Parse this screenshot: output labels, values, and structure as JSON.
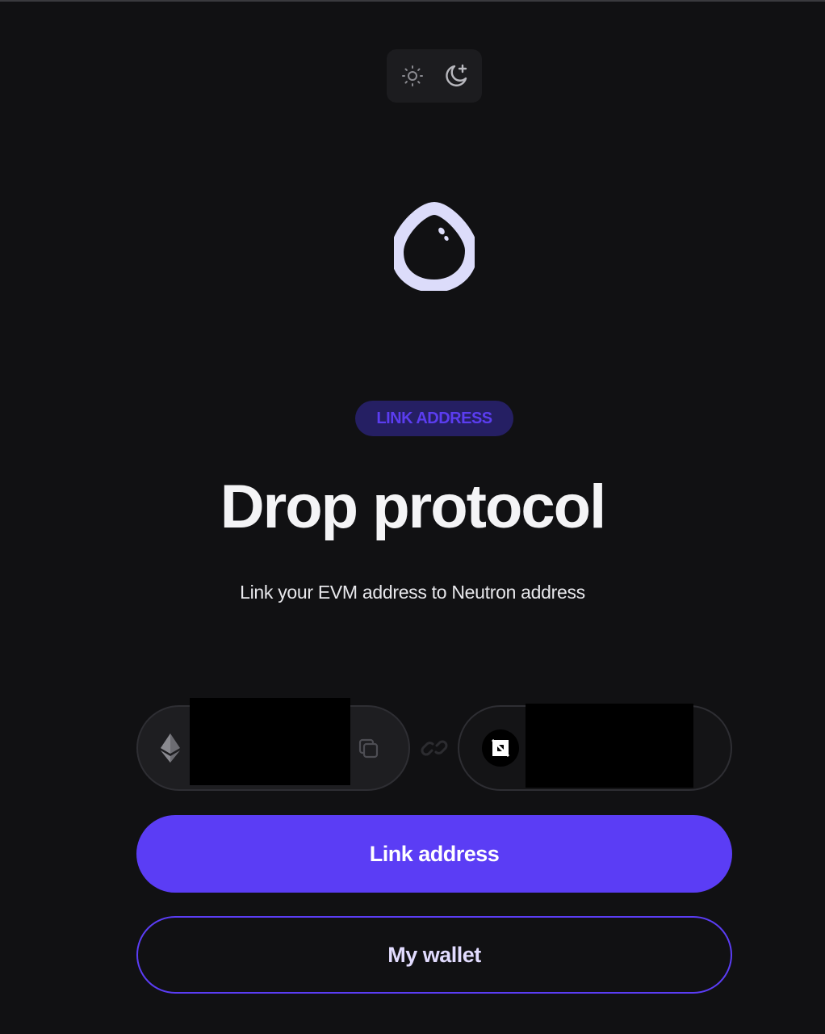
{
  "header": {
    "theme_toggle": {
      "light_icon": "sun-icon",
      "dark_icon": "moon-icon"
    }
  },
  "hero": {
    "logo_icon": "drop-logo-icon",
    "badge": "LINK ADDRESS",
    "title": "Drop protocol",
    "subtitle": "Link your EVM address to Neutron address"
  },
  "addresses": {
    "evm": {
      "icon": "ethereum-icon",
      "copy_icon": "copy-icon"
    },
    "link_icon": "link-icon",
    "neutron": {
      "icon": "neutron-icon"
    }
  },
  "actions": {
    "link_label": "Link address",
    "wallet_label": "My wallet"
  },
  "colors": {
    "background": "#111113",
    "accent": "#5b3df5",
    "badge_bg": "#251f63",
    "badge_text": "#5b3df0",
    "logo": "#dcdcfa"
  }
}
